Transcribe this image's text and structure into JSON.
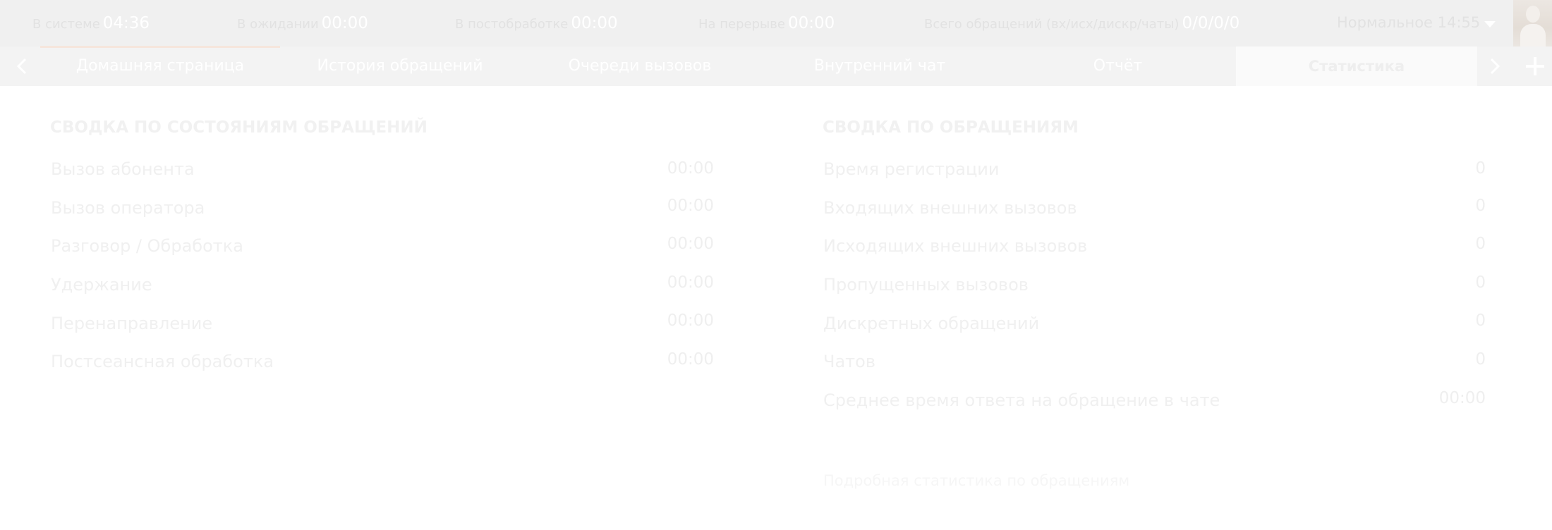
{
  "topbar": {
    "stats": [
      {
        "label": "В системе",
        "value": "04:36"
      },
      {
        "label": "В ожидании",
        "value": "00:00"
      },
      {
        "label": "В постобработке",
        "value": "00:00"
      },
      {
        "label": "На перерыве",
        "value": "00:00"
      },
      {
        "label": "Всего обращений (вх/исх/дискр/чаты)",
        "value": "0/0/0/0"
      }
    ],
    "mode": {
      "label": "Нормальное 14:55"
    }
  },
  "tabs": [
    {
      "label": "Домашняя страница"
    },
    {
      "label": "История обращений"
    },
    {
      "label": "Очереди вызовов"
    },
    {
      "label": "Внутренний чат"
    },
    {
      "label": "Отчёт"
    },
    {
      "label": "Статистика"
    }
  ],
  "states_summary": {
    "title": "СВОДКА ПО СОСТОЯНИЯМ ОБРАЩЕНИЙ",
    "rows": [
      {
        "label": "Вызов абонента",
        "value": "00:00"
      },
      {
        "label": "Вызов оператора",
        "value": "00:00"
      },
      {
        "label": "Разговор / Обработка",
        "value": "00:00"
      },
      {
        "label": "Удержание",
        "value": "00:00"
      },
      {
        "label": "Перенаправление",
        "value": "00:00"
      },
      {
        "label": "Постсеансная обработка",
        "value": "00:00"
      }
    ]
  },
  "calls_summary": {
    "title": "СВОДКА ПО ОБРАЩЕНИЯМ",
    "rows": [
      {
        "label": "Время регистрации",
        "value": "0"
      },
      {
        "label": "Входящих внешних вызовов",
        "value": "0"
      },
      {
        "label": "Исходящих внешних вызовов",
        "value": "0"
      },
      {
        "label": "Пропущенных вызовов",
        "value": "0"
      },
      {
        "label": "Дискретных обращений",
        "value": "0"
      },
      {
        "label": "Чатов",
        "value": "0"
      },
      {
        "label": "Среднее время ответа на обращение в чате",
        "value": "00:00"
      }
    ],
    "link": "Подробная статистика по обращениям"
  },
  "colors": {
    "topbar_bg": "#f0f0f0",
    "tabbar_bg": "#f3f3f3",
    "active_tab_bg": "#fafafa",
    "accent_underline": "#f6e6dc"
  }
}
